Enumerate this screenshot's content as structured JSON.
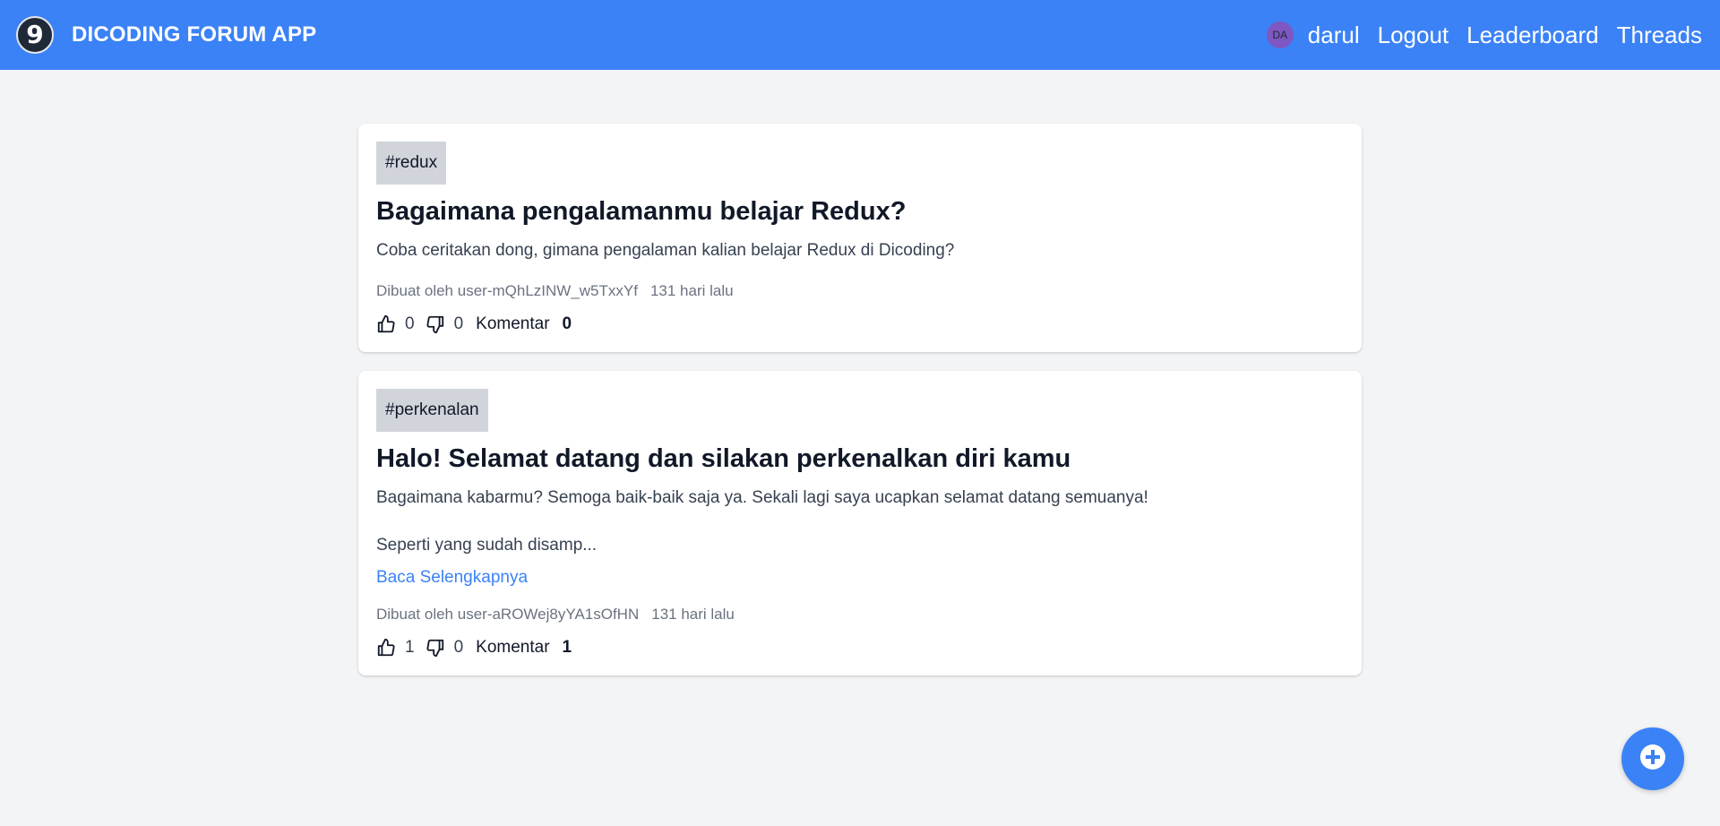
{
  "navbar": {
    "logo_icon": "dicoding-logo-icon",
    "title": "DICODING FORUM APP",
    "avatar_initials": "DA",
    "username": "darul",
    "links": {
      "logout": "Logout",
      "leaderboard": "Leaderboard",
      "threads": "Threads"
    },
    "colors": {
      "background": "#3b82f6",
      "avatar": "#7e57c2"
    }
  },
  "threads": [
    {
      "category": "#redux",
      "title": "Bagaimana pengalamanmu belajar Redux?",
      "body": "Coba ceritakan dong, gimana pengalaman kalian belajar Redux di Dicoding?",
      "author_prefix": "Dibuat oleh",
      "author": "user-mQhLzINW_w5TxxYf",
      "created": "131 hari lalu",
      "upvotes": "0",
      "downvotes": "0",
      "comment_label": "Komentar",
      "comments": "0"
    },
    {
      "category": "#perkenalan",
      "title": "Halo! Selamat datang dan silakan perkenalkan diri kamu",
      "body_line1": "Bagaimana kabarmu? Semoga baik-baik saja ya. Sekali lagi saya ucapkan selamat datang semuanya!",
      "body_line2": "Seperti yang sudah disamp...",
      "read_more": "Baca Selengkapnya",
      "author_prefix": "Dibuat oleh",
      "author": "user-aROWej8yYA1sOfHN",
      "created": "131 hari lalu",
      "upvotes": "1",
      "downvotes": "0",
      "comment_label": "Komentar",
      "comments": "1"
    }
  ],
  "fab": {
    "icon": "add-circle-icon",
    "color": "#3b82f6"
  }
}
